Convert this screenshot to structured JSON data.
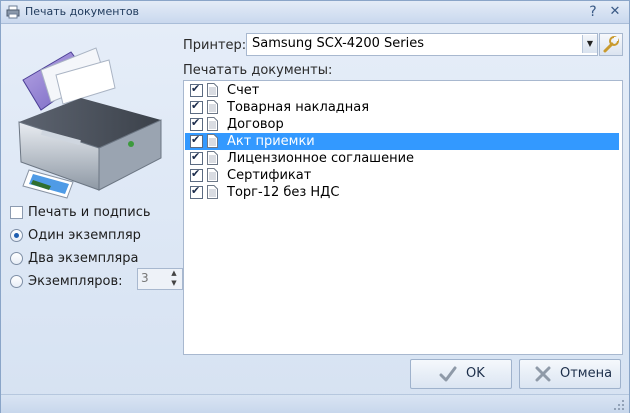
{
  "window": {
    "title": "Печать документов"
  },
  "printer": {
    "label": "Принтер:",
    "value": "Samsung SCX-4200 Series"
  },
  "documents": {
    "label": "Печатать документы:",
    "items": [
      {
        "label": "Счет",
        "checked": true,
        "selected": false
      },
      {
        "label": "Товарная накладная",
        "checked": true,
        "selected": false
      },
      {
        "label": "Договор",
        "checked": true,
        "selected": false
      },
      {
        "label": "Акт приемки",
        "checked": true,
        "selected": true
      },
      {
        "label": "Лицензионное соглашение",
        "checked": true,
        "selected": false
      },
      {
        "label": "Сертификат",
        "checked": true,
        "selected": false
      },
      {
        "label": "Торг-12 без НДС",
        "checked": true,
        "selected": false
      }
    ]
  },
  "options": {
    "print_and_sign": "Печать и подпись",
    "one_copy": "Один экземпляр",
    "two_copies": "Два экземпляра",
    "copies": "Экземпляров:",
    "copies_value": "3",
    "selected_radio": "one_copy"
  },
  "buttons": {
    "ok": "OK",
    "cancel": "Отмена"
  },
  "colors": {
    "selection": "#3399ff",
    "window_bg": "#dfe8f5"
  }
}
